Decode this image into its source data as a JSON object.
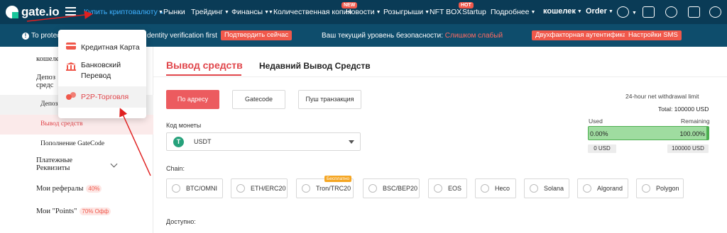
{
  "brand": {
    "name": "gate.io"
  },
  "topnav": {
    "buy_crypto": "Купить криптовалюту",
    "markets": "Рынки",
    "trading": "Трейдинг",
    "finance": "Финансы",
    "copy": "Количественная копия",
    "news": "Новости",
    "news_badge": "NEW",
    "giveaways": "Розыгрыши",
    "nft": "NFT BOX",
    "startup": "Startup",
    "startup_badge": "HOT",
    "more": "Подробнее",
    "wallet": "кошелек",
    "order": "Order"
  },
  "notice": {
    "text_prefix": "To protect",
    "text_suffix": "dentity verification first",
    "confirm_button": "Подтвердить сейчас",
    "level_text": "Ваш текущий уровень безопасности:",
    "level_value": "Слишком слабый",
    "twofa_button": "Двухфакторная аутентификация",
    "sms_button": "Настройки SMS"
  },
  "dropdown": {
    "items": [
      {
        "label": "Кредитная Карта"
      },
      {
        "label_line1": "Банковский",
        "label_line2": "Перевод"
      },
      {
        "label": "P2P-Торговля"
      }
    ]
  },
  "sidebar": {
    "wallet": "кошеле",
    "deposit_line1": "Депоз",
    "deposit_line2": "средс",
    "deposit_sub": "Депозі",
    "withdraw": "Вывод средств",
    "gatecode": "Пополнение GateCode",
    "payment_line1": "Платежные",
    "payment_line2": "Реквизиты",
    "referrals": "Мои рефералы",
    "referrals_badge": "40%",
    "points": "Мои \"Points\"",
    "points_badge": "70% Офф"
  },
  "main": {
    "tab_withdraw": "Вывод средств",
    "tab_recent": "Недавний Вывод Средств",
    "method_address": "По адресу",
    "method_gatecode": "Gatecode",
    "method_push": "Пуш транзакция",
    "coin_label": "Код монеты",
    "coin_value": "USDT",
    "coin_icon": "tether-icon",
    "chain_label": "Chain:",
    "free_badge": "Бесплатно",
    "chains": [
      "BTC/OMNI",
      "ETH/ERC20",
      "Tron/TRC20",
      "BSC/BEP20",
      "EOS",
      "Heco",
      "Solana",
      "Algorand",
      "Polygon"
    ],
    "available_label": "Доступно:"
  },
  "limit": {
    "title": "24-hour net withdrawal limit",
    "total": "Total: 100000 USD",
    "used_label": "Used",
    "remaining_label": "Remaining",
    "used_pct": "0.00%",
    "remaining_pct": "100.00%",
    "used_amount": "0 USD",
    "remaining_amount": "100000 USD"
  },
  "colors": {
    "nav_bg": "#0a3b56",
    "notice_bg": "#0e4d6c",
    "accent_red": "#e0464b",
    "bar_green": "#9fdca0"
  }
}
